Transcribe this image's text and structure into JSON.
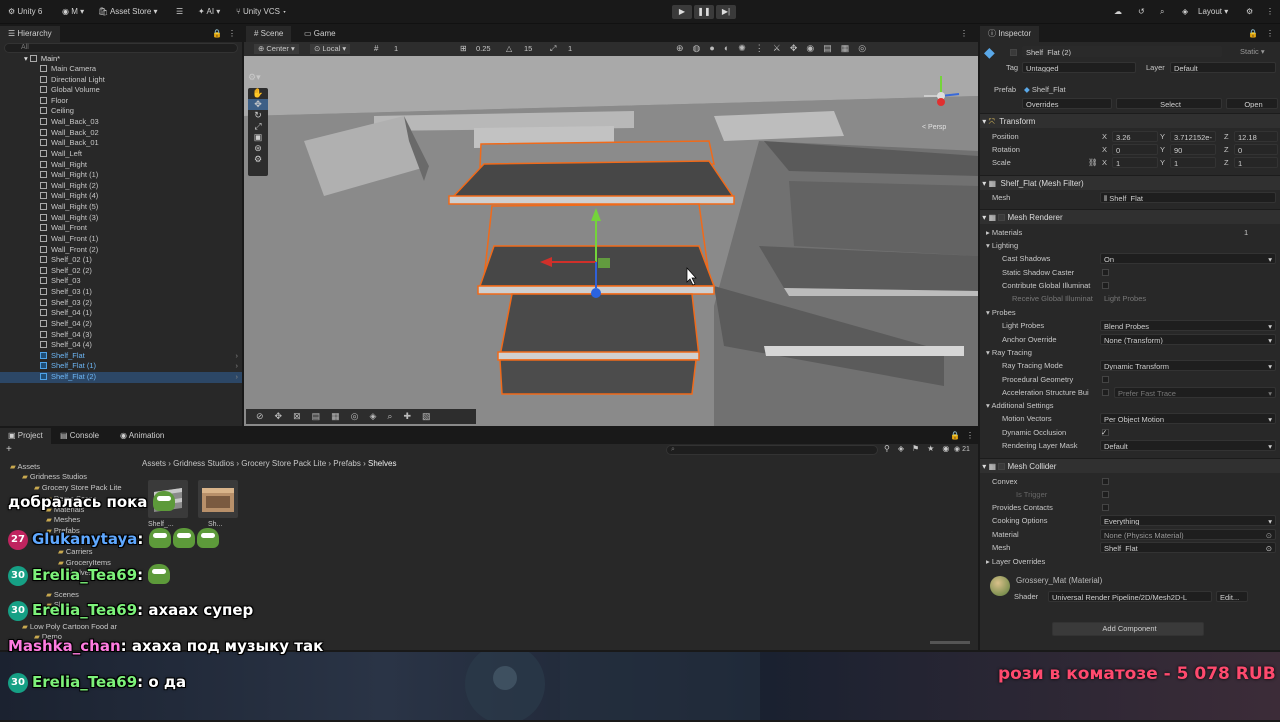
{
  "topbar": {
    "account": "Unity 6",
    "user": "M",
    "asset_store": "Asset Store",
    "ai": "AI",
    "vcs": "Unity VCS",
    "layout": "Layout"
  },
  "hierarchy": {
    "tab": "Hierarchy",
    "search_placeholder": "All",
    "scene": "Main*",
    "items": [
      "Main Camera",
      "Directional Light",
      "Global Volume",
      "Floor",
      "Ceiling",
      "Wall_Back_03",
      "Wall_Back_02",
      "Wall_Back_01",
      "Wall_Left",
      "Wall_Right",
      "Wall_Right (1)",
      "Wall_Right (2)",
      "Wall_Right (4)",
      "Wall_Right (5)",
      "Wall_Right (3)",
      "Wall_Front",
      "Wall_Front (1)",
      "Wall_Front (2)",
      "Shelf_02 (1)",
      "Shelf_02 (2)",
      "Shelf_03",
      "Shelf_03 (1)",
      "Shelf_03 (2)",
      "Shelf_04 (1)",
      "Shelf_04 (2)",
      "Shelf_04 (3)",
      "Shelf_04 (4)"
    ],
    "prefab_items": [
      "Shelf_Flat",
      "Shelf_Flat (1)",
      "Shelf_Flat (2)"
    ]
  },
  "scene_view": {
    "tabs": [
      "Scene",
      "Game"
    ],
    "pivot": "Center",
    "space": "Local",
    "grid_value": "1",
    "snap_value": "0.25",
    "angle_value": "15",
    "scale_value": "1",
    "gizmo_label": "< Persp"
  },
  "inspector": {
    "tab": "Inspector",
    "object_name": "Shelf_Flat (2)",
    "static_label": "Static",
    "tag_label": "Tag",
    "tag_value": "Untagged",
    "layer_label": "Layer",
    "layer_value": "Default",
    "prefab_label": "Prefab",
    "prefab_value": "Shelf_Flat",
    "overrides": "Overrides",
    "select": "Select",
    "open": "Open",
    "transform": {
      "title": "Transform",
      "position_label": "Position",
      "rotation_label": "Rotation",
      "scale_label": "Scale",
      "position": [
        "3.26",
        "3.712152e-",
        "12.18"
      ],
      "rotation": [
        "0",
        "90",
        "0"
      ],
      "scale": [
        "1",
        "1",
        "1"
      ]
    },
    "mesh_filter": {
      "title": "Shelf_Flat (Mesh Filter)",
      "mesh_label": "Mesh",
      "mesh_value": "Shelf_Flat"
    },
    "mesh_renderer": {
      "title": "Mesh Renderer",
      "materials_label": "Materials",
      "materials_count": "1",
      "lighting": "Lighting",
      "cast_shadows_label": "Cast Shadows",
      "cast_shadows_value": "On",
      "static_shadow_caster": "Static Shadow Caster",
      "contribute_gi": "Contribute Global Illuminat",
      "receive_gi": "Receive Global Illuminat",
      "receive_gi_value": "Light Probes",
      "probes": "Probes",
      "light_probes_label": "Light Probes",
      "light_probes_value": "Blend Probes",
      "anchor_override_label": "Anchor Override",
      "anchor_override_value": "None (Transform)",
      "ray_tracing": "Ray Tracing",
      "rt_mode_label": "Ray Tracing Mode",
      "rt_mode_value": "Dynamic Transform",
      "procedural_geometry": "Procedural Geometry",
      "accel_label": "Acceleration Structure Bui",
      "accel_value": "Prefer Fast Trace",
      "additional": "Additional Settings",
      "motion_vectors_label": "Motion Vectors",
      "motion_vectors_value": "Per Object Motion",
      "dynamic_occlusion": "Dynamic Occlusion",
      "rendering_layer_label": "Rendering Layer Mask",
      "rendering_layer_value": "Default"
    },
    "mesh_collider": {
      "title": "Mesh Collider",
      "convex": "Convex",
      "is_trigger": "Is Trigger",
      "provides_contacts": "Provides Contacts",
      "cooking_label": "Cooking Options",
      "cooking_value": "Everything",
      "material_label": "Material",
      "material_value": "None (Physics Material)",
      "mesh_label": "Mesh",
      "mesh_value": "Shelf_Flat"
    },
    "layer_overrides": "Layer Overrides",
    "material": {
      "name": "Grossery_Mat (Material)",
      "shader_label": "Shader",
      "shader_value": "Universal Render Pipeline/2D/Mesh2D-L",
      "edit": "Edit..."
    },
    "add_component": "Add Component"
  },
  "project": {
    "tabs": [
      "Project",
      "Console",
      "Animation"
    ],
    "breadcrumb": [
      "Assets",
      "Gridness Studios",
      "Grocery Store Pack Lite",
      "Prefabs",
      "Shelves"
    ],
    "item_count": "21",
    "tree": [
      "Assets",
      "Gridness Studios",
      "Grocery Store Pack Lite",
      "Demo Scene",
      "Materials",
      "Meshes",
      "Prefabs",
      "Carriers",
      "GroceryItems",
      "Shelves",
      "Scenes",
      "Sky",
      "Low Poly Cartoon Food ar",
      "Demo",
      "Upgrade to SRP Material"
    ],
    "assets": [
      "Shelf_...",
      "Sh..."
    ]
  },
  "chat": [
    {
      "badge": "",
      "user": "",
      "user_color": "#ffffff",
      "text": "добралась пока",
      "emotes": 1
    },
    {
      "badge": "27",
      "badge_color": "#c0245f",
      "user": "Glukanytaya",
      "user_color": "#5fa8ff",
      "text": "",
      "emotes": 3
    },
    {
      "badge": "30",
      "badge_color": "#16a085",
      "user": "Erelia_Tea69",
      "user_color": "#7df27a",
      "text": "",
      "emotes": 1
    },
    {
      "badge": "30",
      "badge_color": "#16a085",
      "user": "Erelia_Tea69",
      "user_color": "#7df27a",
      "text": "ахаах супер",
      "emotes": 0
    },
    {
      "badge": "",
      "user": "Mashka_chan",
      "user_color": "#ff7ce0",
      "text": "ахаха под музыку так",
      "emotes": 0
    },
    {
      "badge": "30",
      "badge_color": "#16a085",
      "user": "Erelia_Tea69",
      "user_color": "#7df27a",
      "text": "о да",
      "emotes": 0
    }
  ],
  "donation": "рози в коматозе - 5 078 RUB"
}
